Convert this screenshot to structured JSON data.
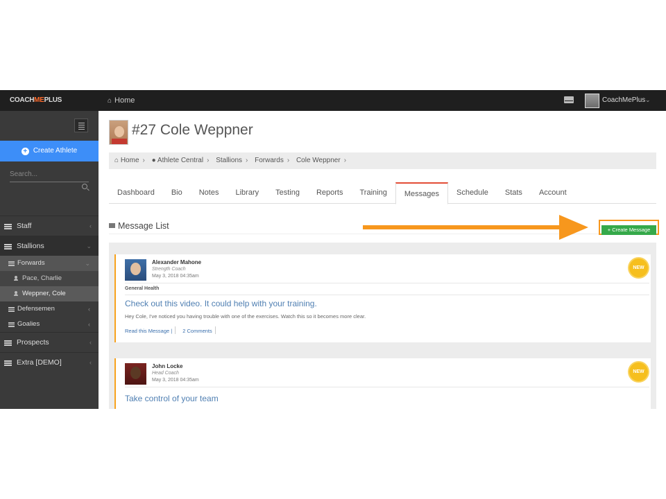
{
  "topbar": {
    "logo_pre": "COACH",
    "logo_me": "ME",
    "logo_post": "PLUS",
    "home_label": "Home",
    "user_name": "CoachMePlus"
  },
  "sidebar": {
    "create_athlete_label": "Create Athlete",
    "search_placeholder": "Search...",
    "items": [
      {
        "label": "Staff"
      },
      {
        "label": "Stallions"
      },
      {
        "label": "Prospects"
      },
      {
        "label": "Extra [DEMO]"
      }
    ],
    "stallions_groups": [
      {
        "label": "Forwards"
      },
      {
        "label": "Defensemen"
      },
      {
        "label": "Goalies"
      }
    ],
    "forwards_athletes": [
      {
        "label": "Pace, Charlie"
      },
      {
        "label": "Weppner, Cole"
      }
    ]
  },
  "page": {
    "athlete_title": "#27 Cole Weppner",
    "breadcrumb": [
      "Home",
      "Athlete Central",
      "Stallions",
      "Forwards",
      "Cole Weppner"
    ],
    "tabs": [
      "Dashboard",
      "Bio",
      "Notes",
      "Library",
      "Testing",
      "Reports",
      "Training",
      "Messages",
      "Schedule",
      "Stats",
      "Account"
    ],
    "active_tab": "Messages",
    "section_title": "Message List",
    "create_message_label": "Create Message"
  },
  "messages": [
    {
      "sender": "Alexander Mahone",
      "role": "Strength Coach",
      "date": "May 3, 2018 04:35am",
      "badge": "NEW",
      "category": "General Health",
      "subject": "Check out this video. It could help with your training.",
      "body": "Hey Cole, I've noticed you having trouble with one of the exercises. Watch this so it becomes more clear.",
      "read_link": "Read this Message |",
      "comments_link": "2 Comments"
    },
    {
      "sender": "John Locke",
      "role": "Head Coach",
      "date": "May 3, 2018 04:35am",
      "badge": "NEW",
      "subject": "Take control of your team"
    }
  ],
  "colors": {
    "accent_blue": "#3d8ef8",
    "arrow_orange": "#f7971d",
    "button_green": "#35a94a",
    "active_tab_red": "#e24d36",
    "badge_gold": "#f6bf1e"
  }
}
